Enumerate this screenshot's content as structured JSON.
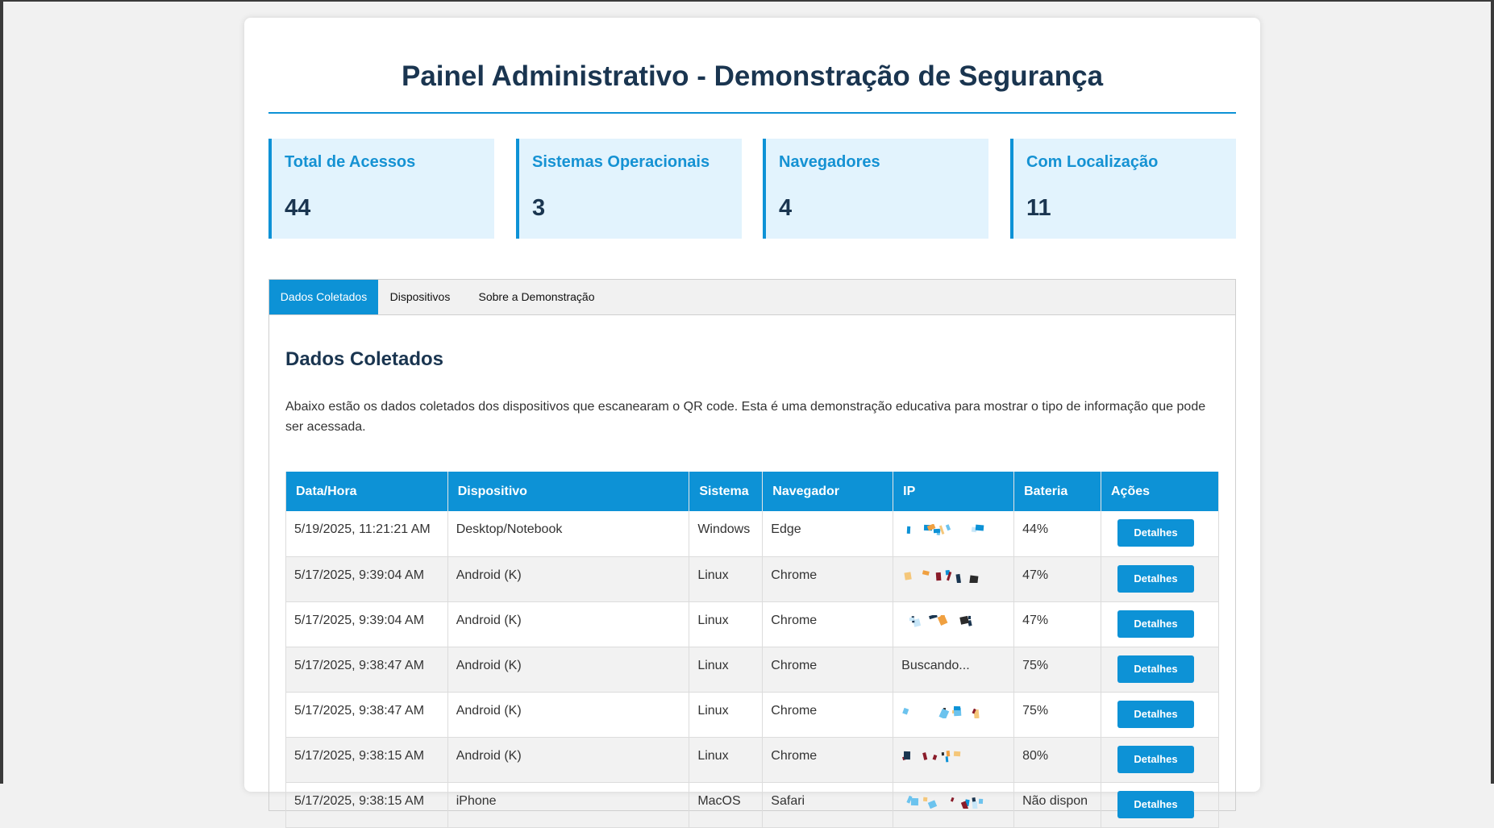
{
  "page": {
    "title": "Painel Administrativo - Demonstração de Segurança"
  },
  "stats": [
    {
      "label": "Total de Acessos",
      "value": "44"
    },
    {
      "label": "Sistemas Operacionais",
      "value": "3"
    },
    {
      "label": "Navegadores",
      "value": "4"
    },
    {
      "label": "Com Localização",
      "value": "11"
    }
  ],
  "tabs": [
    {
      "label": "Dados Coletados",
      "active": true
    },
    {
      "label": "Dispositivos",
      "active": false
    },
    {
      "label": "Sobre a Demonstração",
      "active": false
    }
  ],
  "section": {
    "title": "Dados Coletados",
    "description": "Abaixo estão os dados coletados dos dispositivos que escanearam o QR code. Esta é uma demonstração educativa para mostrar o tipo de informação que pode ser acessada."
  },
  "table": {
    "headers": [
      "Data/Hora",
      "Dispositivo",
      "Sistema",
      "Navegador",
      "IP",
      "Bateria",
      "Ações"
    ],
    "rows": [
      {
        "datetime": "5/19/2025, 11:21:21 AM",
        "device": "Desktop/Notebook",
        "system": "Windows",
        "browser": "Edge",
        "ip": "",
        "battery": "44%",
        "action": "Detalhes"
      },
      {
        "datetime": "5/17/2025, 9:39:04 AM",
        "device": "Android (K)",
        "system": "Linux",
        "browser": "Chrome",
        "ip": "",
        "battery": "47%",
        "action": "Detalhes"
      },
      {
        "datetime": "5/17/2025, 9:39:04 AM",
        "device": "Android (K)",
        "system": "Linux",
        "browser": "Chrome",
        "ip": "",
        "battery": "47%",
        "action": "Detalhes"
      },
      {
        "datetime": "5/17/2025, 9:38:47 AM",
        "device": "Android (K)",
        "system": "Linux",
        "browser": "Chrome",
        "ip": "Buscando...",
        "battery": "75%",
        "action": "Detalhes"
      },
      {
        "datetime": "5/17/2025, 9:38:47 AM",
        "device": "Android (K)",
        "system": "Linux",
        "browser": "Chrome",
        "ip": "",
        "battery": "75%",
        "action": "Detalhes"
      },
      {
        "datetime": "5/17/2025, 9:38:15 AM",
        "device": "Android (K)",
        "system": "Linux",
        "browser": "Chrome",
        "ip": "",
        "battery": "80%",
        "action": "Detalhes"
      },
      {
        "datetime": "5/17/2025, 9:38:15 AM",
        "device": "iPhone",
        "system": "MacOS",
        "browser": "Safari",
        "ip": "",
        "battery": "Não dispon",
        "action": "Detalhes"
      }
    ]
  },
  "colors": {
    "accent": "#0d92d6",
    "title": "#1a3550",
    "stat_bg": "#e2f3fd"
  }
}
